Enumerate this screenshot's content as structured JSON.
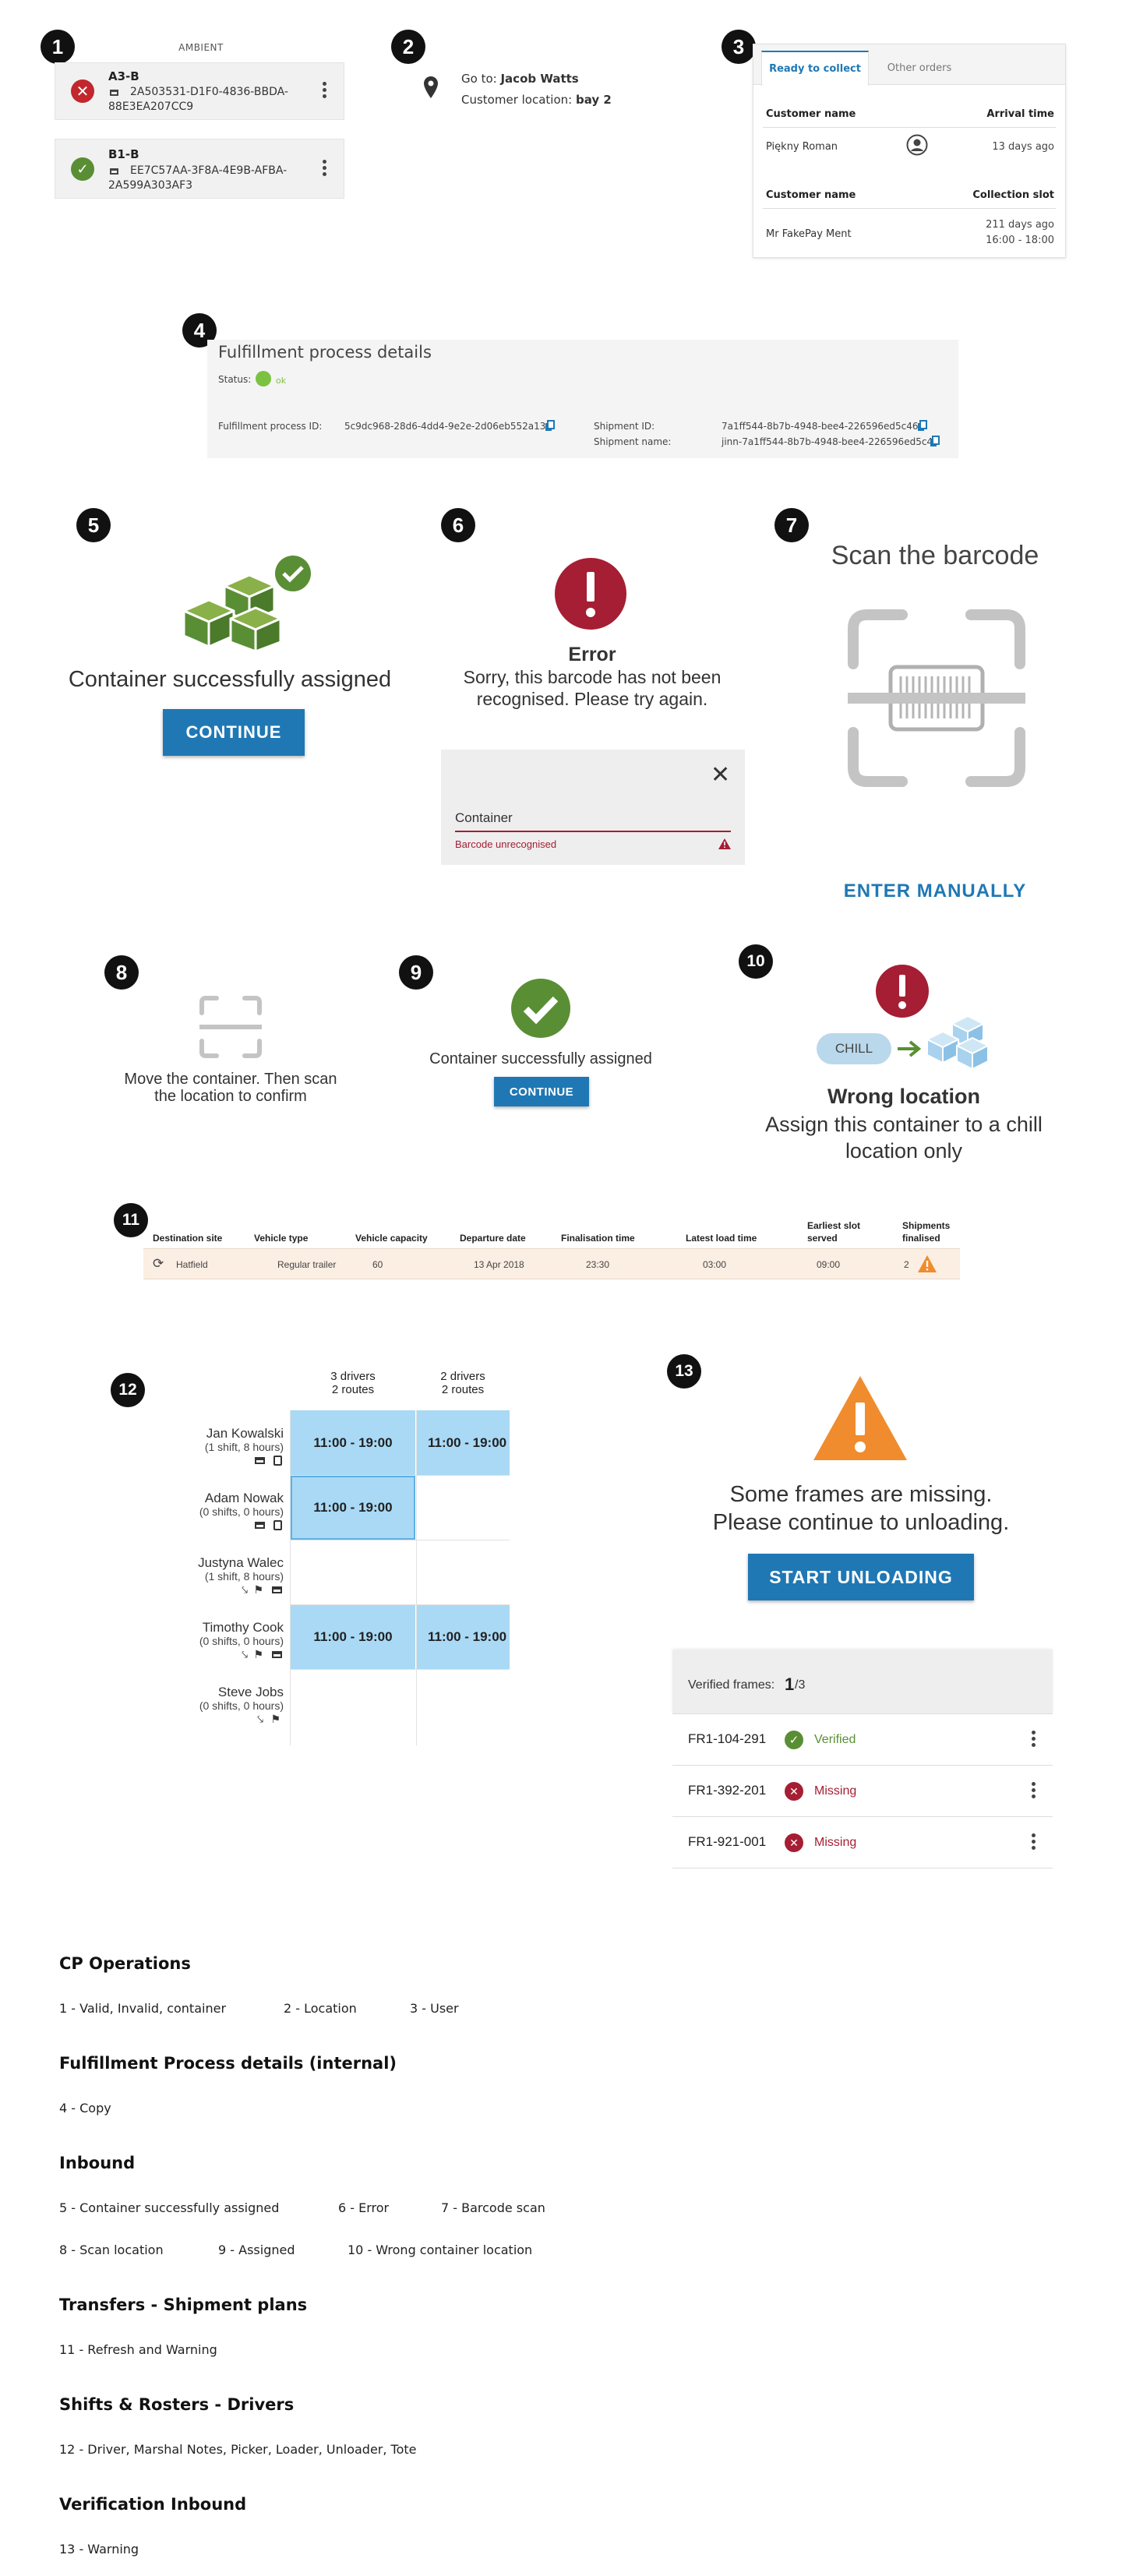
{
  "badges": [
    "1",
    "2",
    "3",
    "4",
    "5",
    "6",
    "7",
    "8",
    "9",
    "10",
    "11",
    "12",
    "13"
  ],
  "containers": {
    "header": "AMBIENT",
    "items": [
      {
        "code": "A3-B",
        "id_line1": "2A503531-D1F0-4836-BBDA-",
        "id_line2": "88E3EA207CC9",
        "status": "invalid"
      },
      {
        "code": "B1-B",
        "id_line1": "EE7C57AA-3F8A-4E9B-AFBA-",
        "id_line2": "2A599A303AF3",
        "status": "valid"
      }
    ]
  },
  "location": {
    "goto_label": "Go to:",
    "goto_name": "Jacob Watts",
    "loc_label": "Customer location:",
    "loc_value": "bay 2"
  },
  "orders": {
    "tabs": [
      "Ready to collect",
      "Other orders"
    ],
    "section1": {
      "col1": "Customer name",
      "col2": "Arrival time",
      "name": "Piękny Roman",
      "time": "13 days ago"
    },
    "section2": {
      "col1": "Customer name",
      "col2": "Collection slot",
      "name": "Mr FakePay Ment",
      "slot1": "211 days ago",
      "slot2": "16:00 - 18:00"
    }
  },
  "fulfillment": {
    "title": "Fulfillment process details",
    "status_label": "Status:",
    "status_value": "ok",
    "process_id_label": "Fulfillment process ID:",
    "process_id": "5c9dc968-28d6-4dd4-9e2e-2d06eb552a13",
    "shipment_id_label": "Shipment ID:",
    "shipment_id": "7a1ff544-8b7b-4948-bee4-226596ed5c46",
    "shipment_name_label": "Shipment name:",
    "shipment_name": "jinn-7a1ff544-8b7b-4948-bee4-226596ed5c46"
  },
  "assigned": {
    "message": "Container successfully assigned",
    "button": "CONTINUE"
  },
  "error": {
    "title": "Error",
    "message_line1": "Sorry, this barcode has not been",
    "message_line2": "recognised. Please try again.",
    "field_label": "Container",
    "field_error": "Barcode unrecognised"
  },
  "scan": {
    "title": "Scan the barcode",
    "manual": "ENTER MANUALLY"
  },
  "scan_location": {
    "line1": "Move the container. Then scan",
    "line2": "the location to confirm"
  },
  "assigned_small": {
    "message": "Container successfully assigned",
    "button": "CONTINUE"
  },
  "wrong_location": {
    "chip": "CHILL",
    "title": "Wrong location",
    "line1": "Assign this container to a chill",
    "line2": "location only"
  },
  "shipment_plans": {
    "headers": [
      "Destination site",
      "Vehicle type",
      "Vehicle capacity",
      "Departure date",
      "Finalisation time",
      "Latest load time",
      "Earliest slot",
      "served",
      "Shipments",
      "finalised"
    ],
    "row": [
      "Hatfield",
      "Regular trailer",
      "60",
      "13 Apr 2018",
      "23:30",
      "03:00",
      "09:00",
      "2"
    ]
  },
  "rosters": {
    "columns": [
      {
        "line1": "3 drivers",
        "line2": "2 routes"
      },
      {
        "line1": "2 drivers",
        "line2": "2 routes"
      }
    ],
    "drivers": [
      {
        "name": "Jan Kowalski",
        "sub": "(1 shift, 8 hours)"
      },
      {
        "name": "Adam Nowak",
        "sub": "(0 shifts, 0 hours)"
      },
      {
        "name": "Justyna Walec",
        "sub": "(1 shift, 8 hours)"
      },
      {
        "name": "Timothy Cook",
        "sub": "(0 shifts, 0 hours)"
      },
      {
        "name": "Steve Jobs",
        "sub": "(0 shifts, 0 hours)"
      }
    ],
    "shift_label": "11:00 - 19:00"
  },
  "verification": {
    "message_line1": "Some frames are missing.",
    "message_line2": "Please continue to unloading.",
    "button": "START UNLOADING",
    "verified_label": "Verified frames:",
    "verified_count": "1",
    "verified_total": "/3",
    "frames": [
      {
        "id": "FR1-104-291",
        "status": "Verified"
      },
      {
        "id": "FR1-392-201",
        "status": "Missing"
      },
      {
        "id": "FR1-921-001",
        "status": "Missing"
      }
    ]
  },
  "legend": [
    {
      "title": "CP Operations",
      "items": [
        "1 - Valid, Invalid, container",
        "2 - Location",
        "3 - User"
      ]
    },
    {
      "title": "Fulfillment Process details (internal)",
      "items": [
        "4 - Copy"
      ]
    },
    {
      "title": "Inbound",
      "items": [
        "5 - Container successfully assigned",
        "6 - Error",
        "7 - Barcode scan",
        "8 - Scan location",
        "9 - Assigned",
        "10 - Wrong container location"
      ]
    },
    {
      "title": "Transfers - Shipment plans",
      "items": [
        "11 - Refresh and Warning"
      ]
    },
    {
      "title": "Shifts & Rosters - Drivers",
      "items": [
        "12 - Driver, Marshal Notes, Picker, Loader, Unloader, Tote"
      ]
    },
    {
      "title": "Verification Inbound",
      "items": [
        "13 - Warning"
      ]
    }
  ],
  "colors": {
    "green": "#5a8e35",
    "red": "#c1272d",
    "blue": "#1f78b4",
    "orange": "#f08c2e",
    "shift": "#a9d9f5"
  }
}
